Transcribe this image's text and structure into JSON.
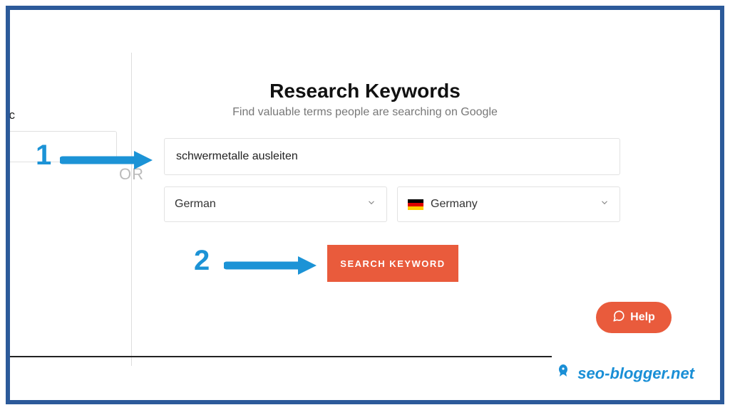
{
  "page": {
    "heading": "Research Keywords",
    "subheading": "Find valuable terms people are searching on Google"
  },
  "partial_label": "fic",
  "or_label": "OR",
  "form": {
    "keyword_value": "schwermetalle ausleiten",
    "language_value": "German",
    "country_value": "Germany",
    "search_button": "SEARCH KEYWORD"
  },
  "help": {
    "label": "Help"
  },
  "annotations": {
    "step1": "1",
    "step2": "2"
  },
  "watermark": {
    "text": "seo-blogger.net"
  }
}
